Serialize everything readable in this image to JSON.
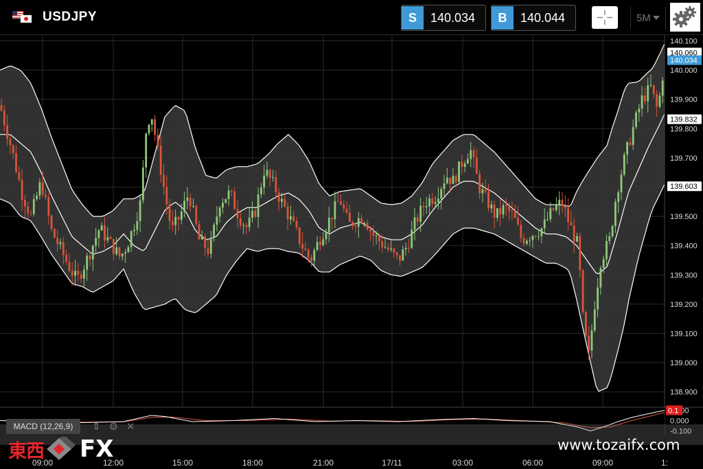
{
  "header": {
    "symbol": "USDJPY",
    "sell": {
      "tag": "S",
      "price": "140.034"
    },
    "buy": {
      "tag": "B",
      "price": "140.044"
    },
    "timeframe": "5M",
    "colors": {
      "accent": "#3f9ad7"
    }
  },
  "price_axis": {
    "ticks": [
      "140.100",
      "140.000",
      "139.900",
      "139.800",
      "139.700",
      "139.600",
      "139.500",
      "139.400",
      "139.300",
      "139.200",
      "139.100",
      "139.000",
      "138.900"
    ],
    "markers": [
      {
        "label": "140.060",
        "style": "white",
        "value": 140.06
      },
      {
        "label": "140.034",
        "style": "blue",
        "value": 140.034
      },
      {
        "label": "139.832",
        "style": "white",
        "value": 139.832
      },
      {
        "label": "139.603",
        "style": "white",
        "value": 139.603
      }
    ]
  },
  "time_axis": {
    "labels": [
      "09:00",
      "12:00",
      "15:00",
      "18:00",
      "21:00",
      "17/11",
      "03:00",
      "06:00",
      "09:00",
      "1:"
    ]
  },
  "macd": {
    "label": "MACD (12,26,9)",
    "axis": [
      "0.100",
      "0.000",
      "-0.100"
    ],
    "value_badge": "0.1"
  },
  "branding": {
    "logo_kanji": "東西",
    "logo_fx": "FX",
    "url": "www.tozaifx.com"
  },
  "chart_data": {
    "type": "candlestick",
    "ylim": [
      138.85,
      140.12
    ],
    "x_labels": [
      "09:00",
      "12:00",
      "15:00",
      "18:00",
      "21:00",
      "17/11",
      "03:00",
      "06:00",
      "09:00"
    ],
    "indicators": [
      "Bollinger Bands",
      "MACD (12,26,9)"
    ],
    "mid_band": [
      [
        0,
        139.78
      ],
      [
        15,
        139.78
      ],
      [
        30,
        139.75
      ],
      [
        45,
        139.72
      ],
      [
        60,
        139.65
      ],
      [
        75,
        139.57
      ],
      [
        90,
        139.5
      ],
      [
        105,
        139.43
      ],
      [
        120,
        139.4
      ],
      [
        135,
        139.37
      ],
      [
        150,
        139.38
      ],
      [
        165,
        139.4
      ],
      [
        180,
        139.44
      ],
      [
        195,
        139.4
      ],
      [
        210,
        139.38
      ],
      [
        225,
        139.45
      ],
      [
        240,
        139.52
      ],
      [
        255,
        139.55
      ],
      [
        270,
        139.52
      ],
      [
        285,
        139.45
      ],
      [
        300,
        139.42
      ],
      [
        315,
        139.43
      ],
      [
        330,
        139.48
      ],
      [
        345,
        139.51
      ],
      [
        360,
        139.53
      ],
      [
        375,
        139.53
      ],
      [
        390,
        139.55
      ],
      [
        405,
        139.57
      ],
      [
        420,
        139.58
      ],
      [
        435,
        139.56
      ],
      [
        450,
        139.52
      ],
      [
        465,
        139.46
      ],
      [
        480,
        139.44
      ],
      [
        495,
        139.46
      ],
      [
        510,
        139.47
      ],
      [
        525,
        139.48
      ],
      [
        540,
        139.46
      ],
      [
        555,
        139.43
      ],
      [
        570,
        139.42
      ],
      [
        585,
        139.42
      ],
      [
        600,
        139.44
      ],
      [
        615,
        139.47
      ],
      [
        630,
        139.52
      ],
      [
        645,
        139.56
      ],
      [
        660,
        139.6
      ],
      [
        675,
        139.62
      ],
      [
        690,
        139.62
      ],
      [
        705,
        139.6
      ],
      [
        720,
        139.58
      ],
      [
        735,
        139.55
      ],
      [
        750,
        139.52
      ],
      [
        765,
        139.49
      ],
      [
        780,
        139.46
      ],
      [
        795,
        139.44
      ],
      [
        810,
        139.44
      ],
      [
        825,
        139.43
      ],
      [
        840,
        139.4
      ],
      [
        855,
        139.35
      ],
      [
        870,
        139.3
      ],
      [
        885,
        139.33
      ],
      [
        900,
        139.45
      ],
      [
        915,
        139.58
      ],
      [
        930,
        139.66
      ],
      [
        945,
        139.74
      ],
      [
        960,
        139.81
      ],
      [
        968,
        139.85
      ]
    ],
    "band_width": [
      [
        0,
        0.22
      ],
      [
        30,
        0.25
      ],
      [
        60,
        0.22
      ],
      [
        90,
        0.18
      ],
      [
        120,
        0.14
      ],
      [
        150,
        0.12
      ],
      [
        180,
        0.12
      ],
      [
        210,
        0.2
      ],
      [
        240,
        0.32
      ],
      [
        270,
        0.34
      ],
      [
        300,
        0.22
      ],
      [
        330,
        0.18
      ],
      [
        360,
        0.14
      ],
      [
        390,
        0.16
      ],
      [
        420,
        0.2
      ],
      [
        450,
        0.17
      ],
      [
        480,
        0.13
      ],
      [
        510,
        0.12
      ],
      [
        540,
        0.11
      ],
      [
        570,
        0.12
      ],
      [
        600,
        0.13
      ],
      [
        630,
        0.16
      ],
      [
        660,
        0.16
      ],
      [
        690,
        0.16
      ],
      [
        720,
        0.14
      ],
      [
        750,
        0.12
      ],
      [
        780,
        0.1
      ],
      [
        810,
        0.1
      ],
      [
        830,
        0.11
      ],
      [
        850,
        0.26
      ],
      [
        870,
        0.4
      ],
      [
        890,
        0.42
      ],
      [
        910,
        0.4
      ],
      [
        930,
        0.3
      ],
      [
        950,
        0.24
      ],
      [
        968,
        0.24
      ]
    ],
    "close": [
      [
        0,
        139.88
      ],
      [
        18,
        139.72
      ],
      [
        32,
        139.58
      ],
      [
        45,
        139.5
      ],
      [
        60,
        139.62
      ],
      [
        75,
        139.45
      ],
      [
        90,
        139.38
      ],
      [
        100,
        139.33
      ],
      [
        112,
        139.28
      ],
      [
        128,
        139.36
      ],
      [
        145,
        139.46
      ],
      [
        160,
        139.41
      ],
      [
        175,
        139.36
      ],
      [
        185,
        139.4
      ],
      [
        195,
        139.47
      ],
      [
        205,
        139.55
      ],
      [
        213,
        139.8
      ],
      [
        220,
        139.86
      ],
      [
        230,
        139.72
      ],
      [
        240,
        139.58
      ],
      [
        250,
        139.45
      ],
      [
        262,
        139.5
      ],
      [
        275,
        139.58
      ],
      [
        290,
        139.42
      ],
      [
        305,
        139.38
      ],
      [
        320,
        139.55
      ],
      [
        335,
        139.58
      ],
      [
        348,
        139.5
      ],
      [
        360,
        139.46
      ],
      [
        372,
        139.52
      ],
      [
        385,
        139.66
      ],
      [
        398,
        139.61
      ],
      [
        410,
        139.55
      ],
      [
        425,
        139.48
      ],
      [
        440,
        139.4
      ],
      [
        452,
        139.35
      ],
      [
        465,
        139.42
      ],
      [
        480,
        139.49
      ],
      [
        495,
        139.56
      ],
      [
        508,
        139.47
      ],
      [
        520,
        139.49
      ],
      [
        530,
        139.5
      ],
      [
        542,
        139.44
      ],
      [
        555,
        139.41
      ],
      [
        568,
        139.38
      ],
      [
        580,
        139.35
      ],
      [
        593,
        139.4
      ],
      [
        605,
        139.48
      ],
      [
        620,
        139.55
      ],
      [
        635,
        139.57
      ],
      [
        650,
        139.64
      ],
      [
        660,
        139.62
      ],
      [
        672,
        139.68
      ],
      [
        685,
        139.73
      ],
      [
        698,
        139.6
      ],
      [
        710,
        139.55
      ],
      [
        722,
        139.5
      ],
      [
        735,
        139.53
      ],
      [
        748,
        139.5
      ],
      [
        760,
        139.42
      ],
      [
        775,
        139.44
      ],
      [
        790,
        139.46
      ],
      [
        805,
        139.52
      ],
      [
        818,
        139.55
      ],
      [
        830,
        139.47
      ],
      [
        842,
        139.4
      ],
      [
        850,
        139.12
      ],
      [
        858,
        139.02
      ],
      [
        865,
        139.18
      ],
      [
        875,
        139.35
      ],
      [
        888,
        139.42
      ],
      [
        898,
        139.58
      ],
      [
        910,
        139.7
      ],
      [
        922,
        139.8
      ],
      [
        935,
        139.9
      ],
      [
        948,
        139.94
      ],
      [
        958,
        139.86
      ],
      [
        968,
        140.03
      ]
    ],
    "macd_series": [
      [
        0,
        0.0
      ],
      [
        60,
        -0.01
      ],
      [
        120,
        -0.02
      ],
      [
        180,
        -0.01
      ],
      [
        220,
        0.05
      ],
      [
        240,
        0.04
      ],
      [
        280,
        -0.01
      ],
      [
        340,
        0.0
      ],
      [
        400,
        0.02
      ],
      [
        460,
        -0.01
      ],
      [
        520,
        0.0
      ],
      [
        580,
        -0.01
      ],
      [
        640,
        0.01
      ],
      [
        690,
        0.02
      ],
      [
        740,
        0.0
      ],
      [
        800,
        -0.01
      ],
      [
        840,
        -0.06
      ],
      [
        860,
        -0.1
      ],
      [
        880,
        -0.06
      ],
      [
        900,
        -0.01
      ],
      [
        920,
        0.03
      ],
      [
        940,
        0.06
      ],
      [
        968,
        0.1
      ]
    ],
    "signal_series": [
      [
        0,
        0.0
      ],
      [
        60,
        0.0
      ],
      [
        120,
        -0.015
      ],
      [
        180,
        -0.012
      ],
      [
        220,
        0.03
      ],
      [
        250,
        0.035
      ],
      [
        300,
        0.0
      ],
      [
        360,
        0.0
      ],
      [
        420,
        0.015
      ],
      [
        480,
        -0.005
      ],
      [
        540,
        0.0
      ],
      [
        600,
        -0.008
      ],
      [
        660,
        0.01
      ],
      [
        710,
        0.015
      ],
      [
        760,
        0.0
      ],
      [
        820,
        -0.02
      ],
      [
        860,
        -0.07
      ],
      [
        890,
        -0.06
      ],
      [
        920,
        0.0
      ],
      [
        945,
        0.04
      ],
      [
        968,
        0.08
      ]
    ]
  }
}
